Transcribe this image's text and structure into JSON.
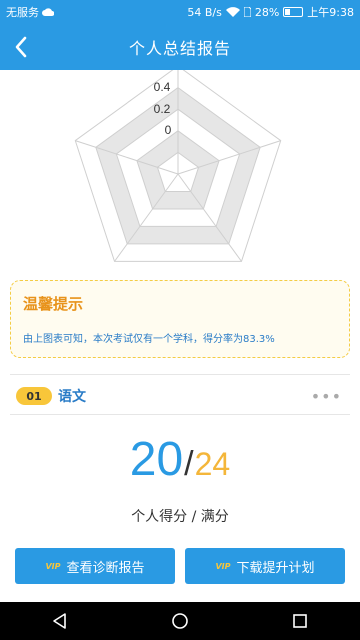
{
  "status_bar": {
    "carrier": "无服务",
    "net_speed": "54 B/s",
    "battery": "28%",
    "time": "上午9:38",
    "battery_level": 0.28
  },
  "header": {
    "title": "个人总结报告"
  },
  "radar": {
    "tick_labels": [
      "0.4",
      "0.2",
      "0"
    ]
  },
  "tip": {
    "title": "温馨提示",
    "text": "由上图表可知，本次考试仅有一个学科，得分率为83.3%"
  },
  "subject": {
    "index": "01",
    "name": "语文",
    "score": "20",
    "separator": "/",
    "total": "24",
    "caption": "个人得分 / 满分"
  },
  "actions": {
    "vip_label": "VIP",
    "view_report": "查看诊断报告",
    "download_plan": "下载提升计划"
  },
  "colors": {
    "primary": "#2a9ae3",
    "accent": "#f8c63a",
    "tip_title": "#e8931b"
  },
  "icons": {
    "back": "chevron-left-icon",
    "more": "more-horizontal-icon",
    "nav_back": "triangle-back-icon",
    "nav_home": "circle-home-icon",
    "nav_recent": "square-recent-icon"
  }
}
